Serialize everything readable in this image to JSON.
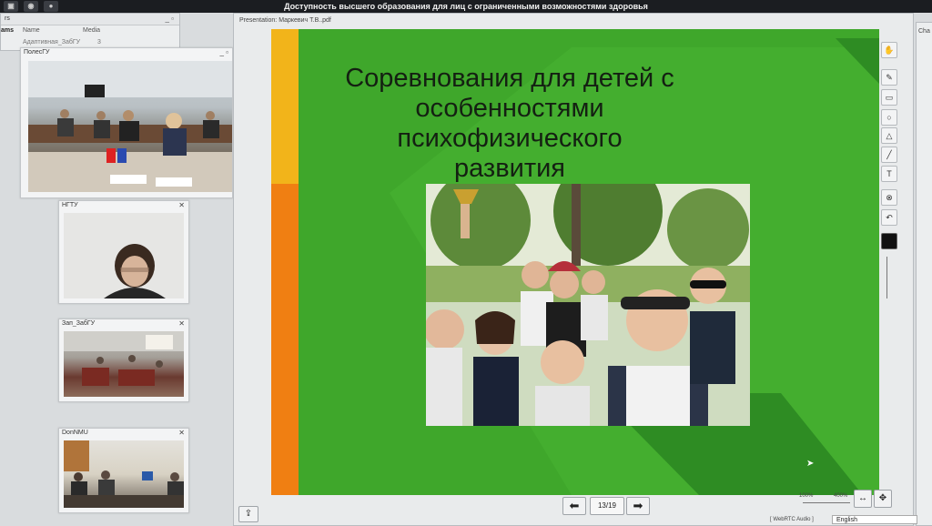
{
  "window": {
    "title": "Доступность высшего образования для лиц с ограниченными возможностями здоровья"
  },
  "left_panel": {
    "header_fragment": "rs",
    "tab_fragment": "ams",
    "columns": [
      "Name",
      "Media"
    ],
    "row": {
      "name": "Адаптивная_ЗабГУ",
      "media": "3"
    }
  },
  "videos": [
    {
      "label": "ПолесГУ"
    },
    {
      "label": "НГТУ"
    },
    {
      "label": "Зап_ЗабГУ"
    },
    {
      "label": "DonNMU"
    }
  ],
  "presentation": {
    "header": "Presentation: Маркевич Т.В..pdf",
    "slide_title_lines": [
      "Соревнования для детей с",
      "особенностями психофизического",
      "развития"
    ],
    "page_indicator": "13/19",
    "zoom_min": "100%",
    "zoom_max": "400%"
  },
  "right_panel": {
    "header_fragment": "Cha"
  },
  "bottom_bar": {
    "audio_label": "[ WebRTC Audio ]",
    "language": "English"
  },
  "colors": {
    "slide_green": "#3fa72b",
    "slide_dark_green": "#2e8c23",
    "accent_orange": "#f07f12",
    "accent_yellow": "#f2b41a"
  },
  "icons": [
    "hand-icon",
    "pencil-icon",
    "rectangle-icon",
    "circle-icon",
    "triangle-icon",
    "line-icon",
    "text-icon",
    "clear-icon",
    "undo-icon",
    "color-swatch-icon",
    "thickness-slider-icon",
    "prev-arrow-icon",
    "next-arrow-icon",
    "fit-width-icon",
    "fit-page-icon",
    "upload-icon"
  ]
}
